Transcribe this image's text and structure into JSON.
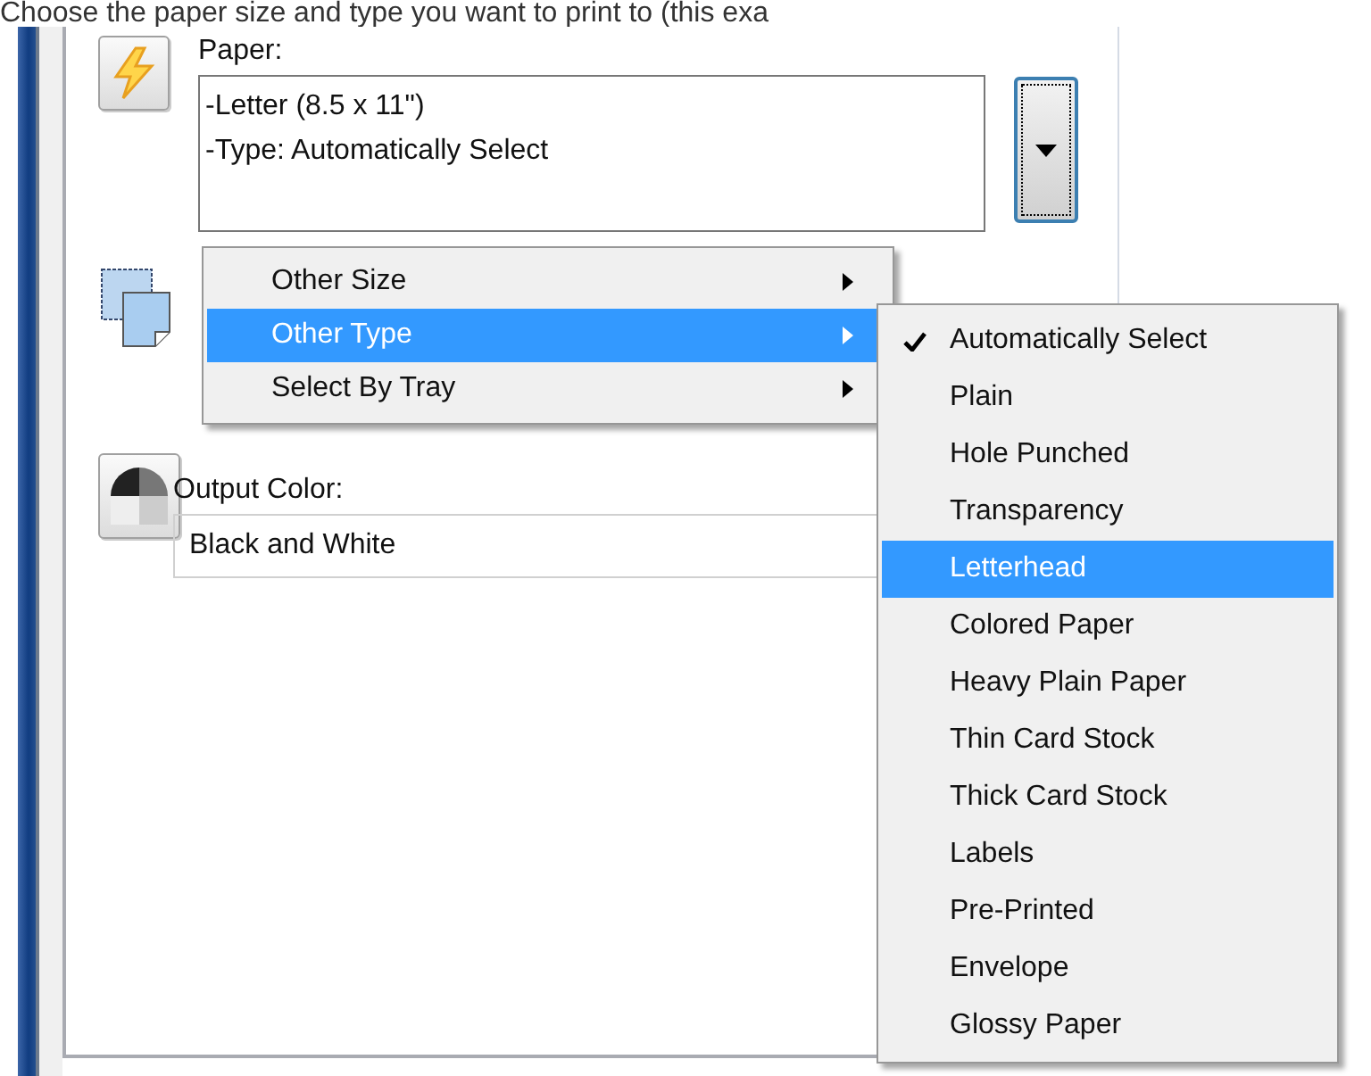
{
  "caption": "Choose the paper size and type you want to print to (this exa",
  "paper": {
    "label": "Paper:",
    "value": "-Letter (8.5 x 11\")\n-Type: Automatically Select"
  },
  "output_color": {
    "label": "Output Color:",
    "value": "Black and White"
  },
  "menu": {
    "items": [
      {
        "label": "Other Size",
        "selected": false
      },
      {
        "label": "Other Type",
        "selected": true
      },
      {
        "label": "Select By Tray",
        "selected": false
      }
    ]
  },
  "submenu": {
    "items": [
      {
        "label": "Automatically Select",
        "checked": true,
        "selected": false
      },
      {
        "label": "Plain",
        "checked": false,
        "selected": false
      },
      {
        "label": "Hole Punched",
        "checked": false,
        "selected": false
      },
      {
        "label": "Transparency",
        "checked": false,
        "selected": false
      },
      {
        "label": "Letterhead",
        "checked": false,
        "selected": true
      },
      {
        "label": "Colored Paper",
        "checked": false,
        "selected": false
      },
      {
        "label": "Heavy Plain Paper",
        "checked": false,
        "selected": false
      },
      {
        "label": "Thin Card Stock",
        "checked": false,
        "selected": false
      },
      {
        "label": "Thick Card Stock",
        "checked": false,
        "selected": false
      },
      {
        "label": "Labels",
        "checked": false,
        "selected": false
      },
      {
        "label": "Pre-Printed",
        "checked": false,
        "selected": false
      },
      {
        "label": "Envelope",
        "checked": false,
        "selected": false
      },
      {
        "label": "Glossy Paper",
        "checked": false,
        "selected": false
      }
    ]
  }
}
